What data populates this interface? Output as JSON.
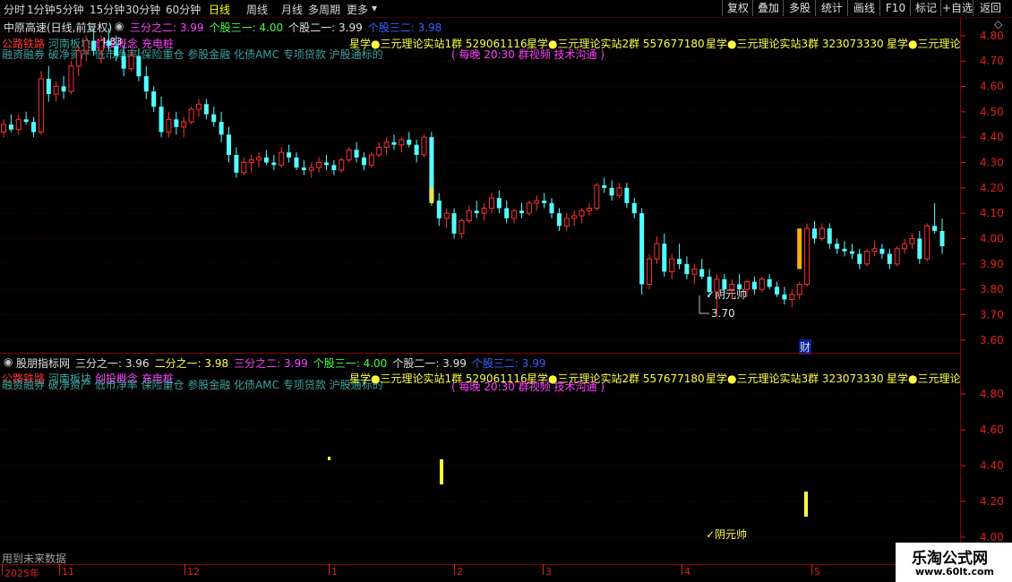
{
  "toolbar": {
    "tabs": [
      "分时",
      "1分钟",
      "5分钟",
      "15分钟",
      "30分钟",
      "60分钟",
      "日线",
      "周线",
      "月线",
      "多周期",
      "更多"
    ],
    "active_tab": "日线",
    "right_buttons": [
      "复权",
      "叠加",
      "多股",
      "统计",
      "画线",
      "F10",
      "标记",
      "+自选",
      "返回"
    ]
  },
  "main_panel": {
    "title": "中原高速(日线,前复权)",
    "indicators": [
      {
        "label": "三分之二: 3.99",
        "color": "#ff40ff"
      },
      {
        "label": "个股三一: 4.00",
        "color": "#40ff40"
      },
      {
        "label": "个股二一: 3.99",
        "color": "#e0e0e0"
      },
      {
        "label": "个股三二: 3.98",
        "color": "#4060ff"
      }
    ],
    "tags_line1": [
      {
        "text": "公路铁路",
        "color": "#ff3030"
      },
      {
        "text": "河南板块",
        "color": "#40a0a0"
      },
      {
        "text": "创投概念",
        "color": "#ff40ff"
      },
      {
        "text": "充电桩",
        "color": "#ff40ff"
      }
    ],
    "high_label": "4.83",
    "tags_line2": "融资融券 破净资产 低市净率 保险重仓 参股金融 化债AMC 专项贷款 沪股通标的",
    "ads": [
      "星学●三元理论实站1群 529061116",
      "星学●三元理论实站2群 557677180",
      "星学●三元理论实站3群 323073330",
      "星学●三元理论"
    ],
    "ad_sub": "( 每晚 20:30 群视频 技术沟通 )",
    "signal_label": "✓阴元帅",
    "low_label": "3.70",
    "cai_label": "财",
    "price_labels": [
      "4.80",
      "4.70",
      "4.60",
      "4.50",
      "4.40",
      "4.30",
      "4.20",
      "4.10",
      "4.00",
      "3.90",
      "3.80",
      "3.70",
      "3.60"
    ]
  },
  "sub_panel": {
    "title": "股朋指标网",
    "indicators": [
      {
        "label": "三分之一: 3.96",
        "color": "#e0e0e0"
      },
      {
        "label": "二分之一: 3.98",
        "color": "#ffff40"
      },
      {
        "label": "三分之二: 3.99",
        "color": "#ff40ff"
      },
      {
        "label": "个股三一: 4.00",
        "color": "#40ff40"
      },
      {
        "label": "个股二一: 3.99",
        "color": "#e0e0e0"
      },
      {
        "label": "个股三二: 3.99",
        "color": "#4060ff"
      }
    ],
    "tags_line1": [
      {
        "text": "公路铁路",
        "color": "#ff3030"
      },
      {
        "text": "河南板块",
        "color": "#40a0a0"
      },
      {
        "text": "创投概念",
        "color": "#ff40ff"
      },
      {
        "text": "充电桩",
        "color": "#ff40ff"
      }
    ],
    "tags_line2": "融资融券 破净资产 低市净率 保险重仓 参股金融 化债AMC 专项贷款 沪股通标的",
    "signal_label": "✓阴元帅",
    "footer_note": "用到未来数据",
    "price_labels": [
      "4.80",
      "4.60",
      "4.40",
      "4.20",
      "4.00"
    ]
  },
  "dates": [
    "2025年",
    "11",
    "12",
    "1",
    "2",
    "3",
    "4",
    "5"
  ],
  "watermark": {
    "title": "乐淘公式网",
    "url": "www.60lt.com"
  },
  "chart_data": {
    "type": "candlestick",
    "ylim": [
      3.55,
      4.87
    ],
    "up_color": "#ff3030",
    "down_color": "#54ffff",
    "candles": [
      [
        4.42,
        4.47,
        4.4,
        4.45
      ],
      [
        4.45,
        4.49,
        4.42,
        4.43
      ],
      [
        4.43,
        4.49,
        4.41,
        4.47
      ],
      [
        4.47,
        4.5,
        4.45,
        4.46
      ],
      [
        4.46,
        4.48,
        4.4,
        4.42
      ],
      [
        4.42,
        4.66,
        4.41,
        4.63
      ],
      [
        4.63,
        4.68,
        4.54,
        4.57
      ],
      [
        4.57,
        4.62,
        4.54,
        4.6
      ],
      [
        4.6,
        4.64,
        4.55,
        4.58
      ],
      [
        4.58,
        4.7,
        4.57,
        4.68
      ],
      [
        4.68,
        4.76,
        4.64,
        4.74
      ],
      [
        4.74,
        4.8,
        4.7,
        4.78
      ],
      [
        4.78,
        4.83,
        4.72,
        4.74
      ],
      [
        4.74,
        4.8,
        4.69,
        4.78
      ],
      [
        4.78,
        4.83,
        4.74,
        4.76
      ],
      [
        4.76,
        4.8,
        4.7,
        4.72
      ],
      [
        4.72,
        4.76,
        4.64,
        4.67
      ],
      [
        4.67,
        4.74,
        4.66,
        4.72
      ],
      [
        4.72,
        4.75,
        4.62,
        4.64
      ],
      [
        4.64,
        4.68,
        4.55,
        4.58
      ],
      [
        4.58,
        4.6,
        4.5,
        4.52
      ],
      [
        4.52,
        4.56,
        4.4,
        4.42
      ],
      [
        4.42,
        4.5,
        4.4,
        4.47
      ],
      [
        4.47,
        4.5,
        4.41,
        4.44
      ],
      [
        4.44,
        4.48,
        4.4,
        4.46
      ],
      [
        4.46,
        4.52,
        4.45,
        4.51
      ],
      [
        4.51,
        4.55,
        4.48,
        4.53
      ],
      [
        4.53,
        4.55,
        4.47,
        4.49
      ],
      [
        4.49,
        4.52,
        4.44,
        4.46
      ],
      [
        4.46,
        4.5,
        4.38,
        4.41
      ],
      [
        4.41,
        4.44,
        4.3,
        4.33
      ],
      [
        4.33,
        4.36,
        4.24,
        4.26
      ],
      [
        4.26,
        4.32,
        4.25,
        4.3
      ],
      [
        4.3,
        4.33,
        4.26,
        4.31
      ],
      [
        4.31,
        4.34,
        4.28,
        4.32
      ],
      [
        4.32,
        4.35,
        4.29,
        4.3
      ],
      [
        4.3,
        4.33,
        4.27,
        4.29
      ],
      [
        4.29,
        4.36,
        4.28,
        4.34
      ],
      [
        4.34,
        4.37,
        4.3,
        4.32
      ],
      [
        4.32,
        4.34,
        4.27,
        4.28
      ],
      [
        4.28,
        4.31,
        4.25,
        4.27
      ],
      [
        4.27,
        4.3,
        4.24,
        4.28
      ],
      [
        4.28,
        4.32,
        4.26,
        4.3
      ],
      [
        4.3,
        4.33,
        4.27,
        4.29
      ],
      [
        4.29,
        4.31,
        4.25,
        4.27
      ],
      [
        4.27,
        4.32,
        4.26,
        4.31
      ],
      [
        4.31,
        4.36,
        4.3,
        4.35
      ],
      [
        4.35,
        4.38,
        4.3,
        4.32
      ],
      [
        4.32,
        4.34,
        4.27,
        4.29
      ],
      [
        4.29,
        4.34,
        4.28,
        4.33
      ],
      [
        4.33,
        4.38,
        4.32,
        4.36
      ],
      [
        4.36,
        4.4,
        4.33,
        4.38
      ],
      [
        4.38,
        4.41,
        4.35,
        4.37
      ],
      [
        4.37,
        4.4,
        4.34,
        4.39
      ],
      [
        4.39,
        4.42,
        4.36,
        4.37
      ],
      [
        4.37,
        4.39,
        4.3,
        4.33
      ],
      [
        4.33,
        4.41,
        4.32,
        4.4
      ],
      [
        4.4,
        4.42,
        4.13,
        4.15
      ],
      [
        4.15,
        4.18,
        4.05,
        4.08
      ],
      [
        4.08,
        4.12,
        4.04,
        4.1
      ],
      [
        4.1,
        4.12,
        4.0,
        4.02
      ],
      [
        4.02,
        4.08,
        4.0,
        4.07
      ],
      [
        4.07,
        4.13,
        4.06,
        4.11
      ],
      [
        4.11,
        4.15,
        4.08,
        4.1
      ],
      [
        4.1,
        4.14,
        4.07,
        4.12
      ],
      [
        4.12,
        4.18,
        4.1,
        4.16
      ],
      [
        4.16,
        4.19,
        4.1,
        4.12
      ],
      [
        4.12,
        4.15,
        4.06,
        4.08
      ],
      [
        4.08,
        4.12,
        4.06,
        4.11
      ],
      [
        4.11,
        4.14,
        4.08,
        4.1
      ],
      [
        4.1,
        4.15,
        4.09,
        4.14
      ],
      [
        4.14,
        4.17,
        4.11,
        4.15
      ],
      [
        4.15,
        4.18,
        4.12,
        4.14
      ],
      [
        4.14,
        4.16,
        4.08,
        4.1
      ],
      [
        4.1,
        4.12,
        4.03,
        4.05
      ],
      [
        4.05,
        4.1,
        4.03,
        4.08
      ],
      [
        4.08,
        4.11,
        4.05,
        4.09
      ],
      [
        4.09,
        4.12,
        4.06,
        4.11
      ],
      [
        4.11,
        4.14,
        4.09,
        4.12
      ],
      [
        4.12,
        4.22,
        4.11,
        4.21
      ],
      [
        4.21,
        4.24,
        4.18,
        4.2
      ],
      [
        4.2,
        4.23,
        4.15,
        4.17
      ],
      [
        4.17,
        4.22,
        4.16,
        4.2
      ],
      [
        4.2,
        4.22,
        4.12,
        4.14
      ],
      [
        4.14,
        4.16,
        4.08,
        4.1
      ],
      [
        4.1,
        4.12,
        3.78,
        3.82
      ],
      [
        3.82,
        3.94,
        3.8,
        3.92
      ],
      [
        3.92,
        4.01,
        3.9,
        3.98
      ],
      [
        3.98,
        4.02,
        3.85,
        3.87
      ],
      [
        3.87,
        3.94,
        3.84,
        3.92
      ],
      [
        3.92,
        3.98,
        3.88,
        3.9
      ],
      [
        3.9,
        3.93,
        3.84,
        3.86
      ],
      [
        3.86,
        3.9,
        3.82,
        3.88
      ],
      [
        3.88,
        3.92,
        3.84,
        3.85
      ],
      [
        3.85,
        3.88,
        3.77,
        3.79
      ],
      [
        3.79,
        3.86,
        3.7,
        3.84
      ],
      [
        3.84,
        3.86,
        3.78,
        3.8
      ],
      [
        3.8,
        3.84,
        3.76,
        3.82
      ],
      [
        3.82,
        3.86,
        3.79,
        3.8
      ],
      [
        3.8,
        3.84,
        3.77,
        3.83
      ],
      [
        3.83,
        3.85,
        3.78,
        3.8
      ],
      [
        3.8,
        3.85,
        3.79,
        3.84
      ],
      [
        3.84,
        3.86,
        3.8,
        3.81
      ],
      [
        3.81,
        3.83,
        3.77,
        3.78
      ],
      [
        3.78,
        3.81,
        3.74,
        3.76
      ],
      [
        3.76,
        3.8,
        3.73,
        3.78
      ],
      [
        3.78,
        3.83,
        3.76,
        3.82
      ],
      [
        3.82,
        4.06,
        3.81,
        4.04
      ],
      [
        4.04,
        4.07,
        3.98,
        4.0
      ],
      [
        4.0,
        4.06,
        3.99,
        4.04
      ],
      [
        4.04,
        4.06,
        3.96,
        3.98
      ],
      [
        3.98,
        4.0,
        3.94,
        3.96
      ],
      [
        3.96,
        3.99,
        3.93,
        3.95
      ],
      [
        3.95,
        3.98,
        3.92,
        3.94
      ],
      [
        3.94,
        3.96,
        3.88,
        3.9
      ],
      [
        3.9,
        3.96,
        3.89,
        3.95
      ],
      [
        3.95,
        3.99,
        3.93,
        3.96
      ],
      [
        3.96,
        3.98,
        3.92,
        3.94
      ],
      [
        3.94,
        3.96,
        3.88,
        3.9
      ],
      [
        3.9,
        3.97,
        3.89,
        3.96
      ],
      [
        3.96,
        4.0,
        3.94,
        3.98
      ],
      [
        3.98,
        4.02,
        3.96,
        4.0
      ],
      [
        4.0,
        4.03,
        3.9,
        3.92
      ],
      [
        3.92,
        4.06,
        3.91,
        4.05
      ],
      [
        4.05,
        4.14,
        4.02,
        4.03
      ],
      [
        4.03,
        4.08,
        3.94,
        3.97
      ]
    ],
    "markers": [
      {
        "index": 57,
        "label": "yellow-bar",
        "from": 4.14,
        "to": 4.2
      },
      {
        "index": 106,
        "label": "yellow-bar",
        "from": 3.88,
        "to": 4.04
      }
    ]
  }
}
